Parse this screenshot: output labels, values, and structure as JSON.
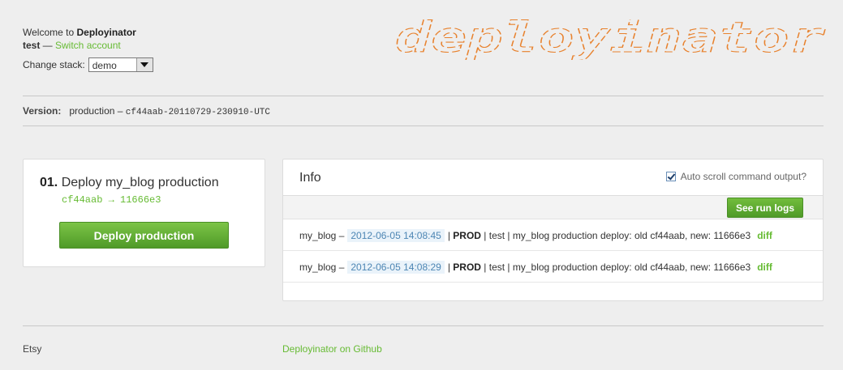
{
  "header": {
    "welcome_prefix": "Welcome to",
    "app_name": "Deployinator",
    "user": "test",
    "separator": " — ",
    "switch_account": "Switch account",
    "change_stack_label": "Change stack:",
    "stack_value": "demo"
  },
  "logo": {
    "text": "deployinator",
    "color": "#e8822e"
  },
  "version": {
    "label": "Version:",
    "env": "production –",
    "value": "cf44aab-20110729-230910-UTC"
  },
  "deploy_card": {
    "number": "01.",
    "title": "Deploy my_blog production",
    "sha_from": "cf44aab",
    "arrow": "→",
    "sha_to": "11666e3",
    "button_label": "Deploy production"
  },
  "info": {
    "title": "Info",
    "autoscroll_label": "Auto scroll command output?",
    "autoscroll_checked": true,
    "run_logs_button": "See run logs",
    "logs": [
      {
        "app": "my_blog –",
        "timestamp": "2012-06-05 14:08:45",
        "sep1": "|",
        "env": "PROD",
        "rest": "| test | my_blog production deploy: old cf44aab, new: 11666e3",
        "link": "diff"
      },
      {
        "app": "my_blog –",
        "timestamp": "2012-06-05 14:08:29",
        "sep1": "|",
        "env": "PROD",
        "rest": "| test | my_blog production deploy: old cf44aab, new: 11666e3",
        "link": "diff"
      }
    ]
  },
  "footer": {
    "left": "Etsy",
    "right_link": "Deployinator on Github"
  },
  "colors": {
    "accent_green": "#66bb33",
    "button_green": "#5aa531",
    "timestamp_blue": "#4d86b4"
  }
}
